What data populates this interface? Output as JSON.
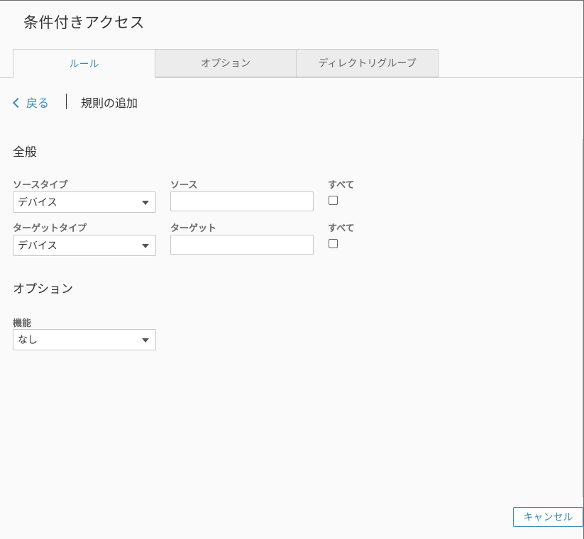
{
  "page": {
    "title": "条件付きアクセス"
  },
  "tabs": [
    {
      "label": "ルール",
      "active": true
    },
    {
      "label": "オプション",
      "active": false
    },
    {
      "label": "ディレクトリグループ",
      "active": false
    }
  ],
  "breadcrumb": {
    "back_label": "戻る",
    "current": "規則の追加"
  },
  "general": {
    "heading": "全般",
    "source_type": {
      "label": "ソースタイプ",
      "value": "デバイス"
    },
    "source": {
      "label": "ソース",
      "value": "",
      "placeholder": ""
    },
    "source_all": {
      "label": "すべて",
      "checked": false
    },
    "target_type": {
      "label": "ターゲットタイプ",
      "value": "デバイス"
    },
    "target": {
      "label": "ターゲット",
      "value": "",
      "placeholder": ""
    },
    "target_all": {
      "label": "すべて",
      "checked": false
    }
  },
  "options": {
    "heading": "オプション",
    "feature": {
      "label": "機能",
      "value": "なし"
    }
  },
  "footer": {
    "cancel_label": "キャンセル"
  },
  "colors": {
    "accent": "#3a8ab4",
    "background": "#fafafa",
    "border": "#c8c8c8"
  }
}
